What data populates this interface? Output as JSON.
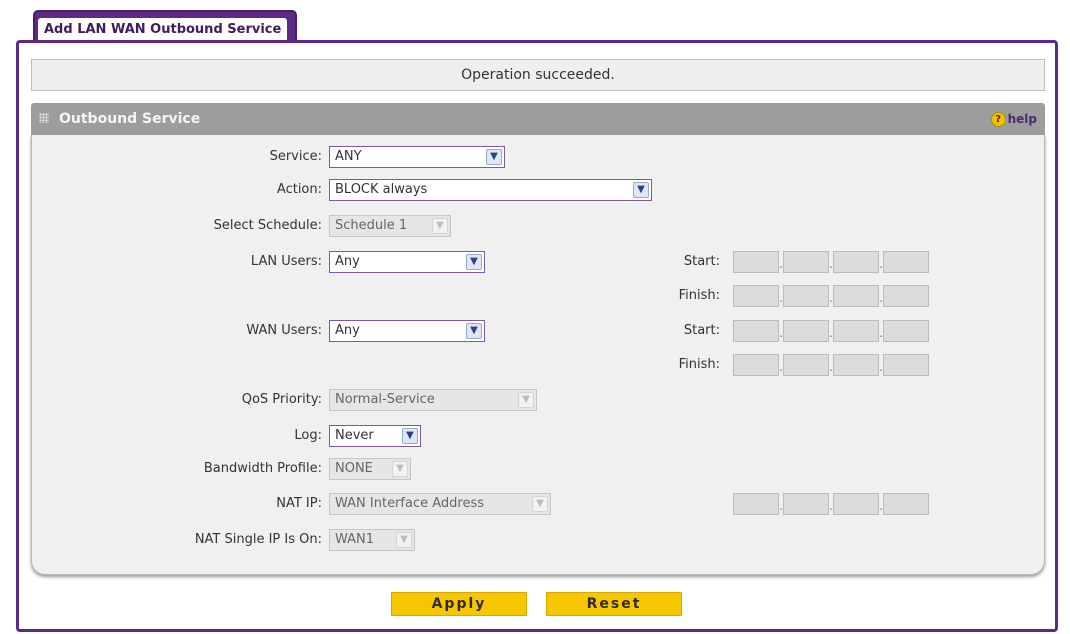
{
  "tab": {
    "title": "Add LAN WAN Outbound Service"
  },
  "status": {
    "message": "Operation succeeded."
  },
  "section": {
    "title": "Outbound Service",
    "help_label": "help"
  },
  "form": {
    "service": {
      "label": "Service:",
      "value": "ANY"
    },
    "action": {
      "label": "Action:",
      "value": "BLOCK always"
    },
    "schedule": {
      "label": "Select Schedule:",
      "value": "Schedule 1"
    },
    "lan_users": {
      "label": "LAN Users:",
      "value": "Any"
    },
    "wan_users": {
      "label": "WAN Users:",
      "value": "Any"
    },
    "qos": {
      "label": "QoS Priority:",
      "value": "Normal-Service"
    },
    "log": {
      "label": "Log:",
      "value": "Never"
    },
    "bandwidth": {
      "label": "Bandwidth Profile:",
      "value": "NONE"
    },
    "nat_ip": {
      "label": "NAT IP:",
      "value": "WAN Interface Address"
    },
    "nat_single": {
      "label": "NAT Single IP Is On:",
      "value": "WAN1"
    },
    "lan_start_label": "Start:",
    "lan_finish_label": "Finish:",
    "wan_start_label": "Start:",
    "wan_finish_label": "Finish:"
  },
  "buttons": {
    "apply": "Apply",
    "reset": "Reset"
  },
  "colors": {
    "accent": "#5b2a86",
    "button": "#f6c600",
    "header": "#9d9d9d"
  },
  "icons": {
    "dropdown": "chevron-down-icon",
    "help": "help-icon",
    "grip": "grip-icon"
  }
}
